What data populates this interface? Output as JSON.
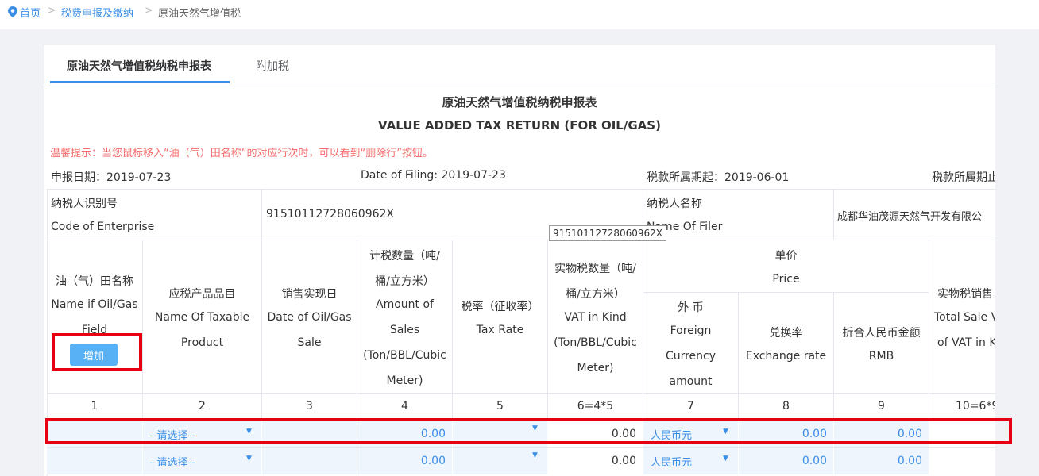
{
  "breadcrumb": {
    "home": "首页",
    "level2": "税费申报及缴纳",
    "current": "原油天然气增值税",
    "separator": ">"
  },
  "tabs": [
    {
      "label": "原油天然气增值税纳税申报表",
      "active": true
    },
    {
      "label": "附加税",
      "active": false
    }
  ],
  "form": {
    "title_cn": "原油天然气增值税纳税申报表",
    "title_en": "VALUE ADDED TAX RETURN (FOR OIL/GAS)",
    "hint": "温馨提示：当您鼠标移入“油（气）田名称”的对应行次时，可以看到“删除行”按钮。",
    "filing_date_cn": "申报日期：2019-07-23",
    "filing_date_en": "Date of Filing: 2019-07-23",
    "period_start": "税款所属期起：2019-06-01",
    "period_end_partial": "税款所属期止"
  },
  "taxpayer": {
    "id_label_cn": "纳税人识别号",
    "id_label_en": "Code of Enterprise",
    "id_value": "91510112728060962X",
    "name_label_cn": "纳税人名称",
    "name_label_en": "Name Of Filer",
    "name_value": "成都华油茂源天然气开发有限公"
  },
  "tooltip": "91510112728060962X",
  "headers": {
    "c1": [
      "油（气）田名称",
      "Name if Oil/Gas",
      "Field"
    ],
    "c2": [
      "应税产品品目",
      "Name Of Taxable",
      "Product"
    ],
    "c3": [
      "销售实现日",
      "Date of Oil/Gas",
      "Sale"
    ],
    "c4": [
      "计税数量（吨/",
      "桶/立方米）",
      "Amount of",
      "Sales",
      "(Ton/BBL/Cubic",
      "Meter)"
    ],
    "c5": [
      "税率（征收率）",
      "Tax Rate"
    ],
    "c6": [
      "实物税数量（吨/",
      "桶/立方米）",
      "VAT in Kind",
      "(Ton/BBL/Cubic",
      "Meter)"
    ],
    "price": [
      "单价",
      "Price"
    ],
    "c7": [
      "外 币",
      "Foreign",
      "Currency",
      "amount"
    ],
    "c8": [
      "兑换率",
      "Exchange rate"
    ],
    "c9": [
      "折合人民币金额",
      "RMB"
    ],
    "c10": [
      "实物税销售",
      "Total Sale V",
      "of VAT in K"
    ]
  },
  "add_button": "增加",
  "col_numbers": [
    "1",
    "2",
    "3",
    "4",
    "5",
    "6=4*5",
    "7",
    "8",
    "9",
    "10=6*9"
  ],
  "rows": [
    {
      "product": "--请选择--",
      "amount": "0.00",
      "vat_kind": "0.00",
      "currency": "人民币元",
      "exchange": "0.00",
      "rmb": "0.00"
    },
    {
      "product": "--请选择--",
      "amount": "0.00",
      "vat_kind": "0.00",
      "currency": "人民币元",
      "exchange": "0.00",
      "rmb": "0.00"
    }
  ],
  "colors": {
    "accent": "#3a8ee6",
    "highlight": "#e60012",
    "hint": "#f56c6c",
    "button": "#58b0f5"
  },
  "icons": {
    "location": "location-pin-icon",
    "dropdown": "caret-down-icon"
  }
}
